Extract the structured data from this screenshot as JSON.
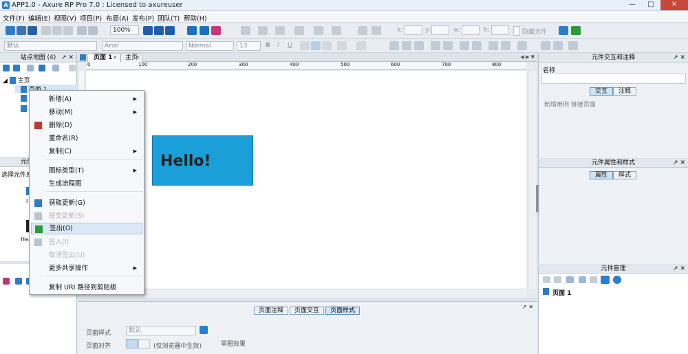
{
  "window": {
    "title": "APP1.0 - Axure RP Pro 7.0 : Licensed to axureuser",
    "minimize": "—",
    "maximize": "□",
    "close": "✕"
  },
  "menu": [
    "文件(F)",
    "编辑(E)",
    "视图(V)",
    "项目(P)",
    "布局(A)",
    "发布(P)",
    "团队(T)",
    "帮助(H)"
  ],
  "toolbar": {
    "zoom": "100%",
    "font_style": "默认",
    "font_family": "Arial",
    "font_weight": "Normal",
    "font_size": "13",
    "x_label": "x:",
    "y_label": "y:",
    "w_label": "w:",
    "h_label": "h:",
    "hide_label": "隐藏元件"
  },
  "sitemap": {
    "title": "站点地图 (4)",
    "root": "主页",
    "selected_page": "页面 1"
  },
  "widgets": {
    "title": "元件",
    "select_label": "选择元件库",
    "item_labels": [
      "I",
      "Hea"
    ]
  },
  "tabs": [
    {
      "label": "页面 1",
      "close": "×"
    },
    {
      "label": "主页",
      "close": "×"
    }
  ],
  "tab_overflow": "◀ ▶ ▼",
  "ruler": {
    "marks": [
      "0",
      "100",
      "200",
      "300",
      "400",
      "500",
      "600",
      "700",
      "800"
    ]
  },
  "canvas": {
    "button_text": "Hello!",
    "button_color": "#1a9fd8"
  },
  "context_menu": [
    {
      "label": "新增(A)",
      "submenu": true,
      "enabled": true
    },
    {
      "label": "移动(M)",
      "submenu": true,
      "enabled": true
    },
    {
      "label": "删除(D)",
      "submenu": false,
      "enabled": true
    },
    {
      "label": "重命名(R)",
      "submenu": false,
      "enabled": true
    },
    {
      "label": "复制(C)",
      "submenu": true,
      "enabled": true
    },
    {
      "label": "图标类型(T)",
      "submenu": true,
      "enabled": true
    },
    {
      "label": "生成流程图",
      "submenu": false,
      "enabled": true
    },
    {
      "label": "获取更新(G)",
      "submenu": false,
      "enabled": true
    },
    {
      "label": "提交更新(S)",
      "submenu": false,
      "enabled": false
    },
    {
      "label": "签出(O)",
      "submenu": false,
      "enabled": true,
      "highlight": true
    },
    {
      "label": "签入(I)",
      "submenu": false,
      "enabled": false
    },
    {
      "label": "取消签出(U)",
      "submenu": false,
      "enabled": false
    },
    {
      "label": "更多共享操作",
      "submenu": true,
      "enabled": true
    },
    {
      "label": "复制 URI 路径到剪贴板",
      "submenu": false,
      "enabled": true
    }
  ],
  "page_props": {
    "tabs": [
      "页面注释",
      "页面交互",
      "页面样式"
    ],
    "active_tab": "页面样式",
    "style_label": "页面样式",
    "style_value": "默认",
    "align_label": "页面对齐",
    "align_note": "(仅浏览器中生效)",
    "sketch_label": "草图效果"
  },
  "right_panel1": {
    "title": "元件交互和注释",
    "name_label": "名称",
    "tabs": [
      "交互",
      "注释"
    ],
    "links": "新增用例  链接页面"
  },
  "right_panel2": {
    "title": "元件属性和样式",
    "tabs": [
      "属性",
      "样式"
    ]
  },
  "right_panel3": {
    "title": "元件管理",
    "page_item": "页面 1"
  }
}
